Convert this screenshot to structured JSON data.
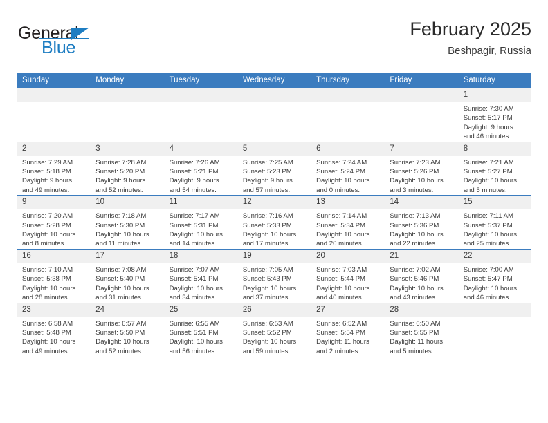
{
  "brand": {
    "name_line1": "General",
    "name_line2": "Blue",
    "logo_icon": "triangle-flag-icon",
    "accent_color": "#1d7dc2"
  },
  "header": {
    "title": "February 2025",
    "subtitle": "Beshpagir, Russia"
  },
  "theme": {
    "header_blue": "#3b7cbf",
    "daynum_band": "#f0f0f0",
    "text": "#3b3b3b"
  },
  "calendar": {
    "weekday_headers": [
      "Sunday",
      "Monday",
      "Tuesday",
      "Wednesday",
      "Thursday",
      "Friday",
      "Saturday"
    ],
    "labels": {
      "sunrise": "Sunrise:",
      "sunset": "Sunset:",
      "daylight": "Daylight:"
    },
    "weeks": [
      [
        {
          "day": "",
          "sunrise": "",
          "sunset": "",
          "daylight_l1": "",
          "daylight_l2": ""
        },
        {
          "day": "",
          "sunrise": "",
          "sunset": "",
          "daylight_l1": "",
          "daylight_l2": ""
        },
        {
          "day": "",
          "sunrise": "",
          "sunset": "",
          "daylight_l1": "",
          "daylight_l2": ""
        },
        {
          "day": "",
          "sunrise": "",
          "sunset": "",
          "daylight_l1": "",
          "daylight_l2": ""
        },
        {
          "day": "",
          "sunrise": "",
          "sunset": "",
          "daylight_l1": "",
          "daylight_l2": ""
        },
        {
          "day": "",
          "sunrise": "",
          "sunset": "",
          "daylight_l1": "",
          "daylight_l2": ""
        },
        {
          "day": "1",
          "sunrise": "Sunrise: 7:30 AM",
          "sunset": "Sunset: 5:17 PM",
          "daylight_l1": "Daylight: 9 hours",
          "daylight_l2": "and 46 minutes."
        }
      ],
      [
        {
          "day": "2",
          "sunrise": "Sunrise: 7:29 AM",
          "sunset": "Sunset: 5:18 PM",
          "daylight_l1": "Daylight: 9 hours",
          "daylight_l2": "and 49 minutes."
        },
        {
          "day": "3",
          "sunrise": "Sunrise: 7:28 AM",
          "sunset": "Sunset: 5:20 PM",
          "daylight_l1": "Daylight: 9 hours",
          "daylight_l2": "and 52 minutes."
        },
        {
          "day": "4",
          "sunrise": "Sunrise: 7:26 AM",
          "sunset": "Sunset: 5:21 PM",
          "daylight_l1": "Daylight: 9 hours",
          "daylight_l2": "and 54 minutes."
        },
        {
          "day": "5",
          "sunrise": "Sunrise: 7:25 AM",
          "sunset": "Sunset: 5:23 PM",
          "daylight_l1": "Daylight: 9 hours",
          "daylight_l2": "and 57 minutes."
        },
        {
          "day": "6",
          "sunrise": "Sunrise: 7:24 AM",
          "sunset": "Sunset: 5:24 PM",
          "daylight_l1": "Daylight: 10 hours",
          "daylight_l2": "and 0 minutes."
        },
        {
          "day": "7",
          "sunrise": "Sunrise: 7:23 AM",
          "sunset": "Sunset: 5:26 PM",
          "daylight_l1": "Daylight: 10 hours",
          "daylight_l2": "and 3 minutes."
        },
        {
          "day": "8",
          "sunrise": "Sunrise: 7:21 AM",
          "sunset": "Sunset: 5:27 PM",
          "daylight_l1": "Daylight: 10 hours",
          "daylight_l2": "and 5 minutes."
        }
      ],
      [
        {
          "day": "9",
          "sunrise": "Sunrise: 7:20 AM",
          "sunset": "Sunset: 5:28 PM",
          "daylight_l1": "Daylight: 10 hours",
          "daylight_l2": "and 8 minutes."
        },
        {
          "day": "10",
          "sunrise": "Sunrise: 7:18 AM",
          "sunset": "Sunset: 5:30 PM",
          "daylight_l1": "Daylight: 10 hours",
          "daylight_l2": "and 11 minutes."
        },
        {
          "day": "11",
          "sunrise": "Sunrise: 7:17 AM",
          "sunset": "Sunset: 5:31 PM",
          "daylight_l1": "Daylight: 10 hours",
          "daylight_l2": "and 14 minutes."
        },
        {
          "day": "12",
          "sunrise": "Sunrise: 7:16 AM",
          "sunset": "Sunset: 5:33 PM",
          "daylight_l1": "Daylight: 10 hours",
          "daylight_l2": "and 17 minutes."
        },
        {
          "day": "13",
          "sunrise": "Sunrise: 7:14 AM",
          "sunset": "Sunset: 5:34 PM",
          "daylight_l1": "Daylight: 10 hours",
          "daylight_l2": "and 20 minutes."
        },
        {
          "day": "14",
          "sunrise": "Sunrise: 7:13 AM",
          "sunset": "Sunset: 5:36 PM",
          "daylight_l1": "Daylight: 10 hours",
          "daylight_l2": "and 22 minutes."
        },
        {
          "day": "15",
          "sunrise": "Sunrise: 7:11 AM",
          "sunset": "Sunset: 5:37 PM",
          "daylight_l1": "Daylight: 10 hours",
          "daylight_l2": "and 25 minutes."
        }
      ],
      [
        {
          "day": "16",
          "sunrise": "Sunrise: 7:10 AM",
          "sunset": "Sunset: 5:38 PM",
          "daylight_l1": "Daylight: 10 hours",
          "daylight_l2": "and 28 minutes."
        },
        {
          "day": "17",
          "sunrise": "Sunrise: 7:08 AM",
          "sunset": "Sunset: 5:40 PM",
          "daylight_l1": "Daylight: 10 hours",
          "daylight_l2": "and 31 minutes."
        },
        {
          "day": "18",
          "sunrise": "Sunrise: 7:07 AM",
          "sunset": "Sunset: 5:41 PM",
          "daylight_l1": "Daylight: 10 hours",
          "daylight_l2": "and 34 minutes."
        },
        {
          "day": "19",
          "sunrise": "Sunrise: 7:05 AM",
          "sunset": "Sunset: 5:43 PM",
          "daylight_l1": "Daylight: 10 hours",
          "daylight_l2": "and 37 minutes."
        },
        {
          "day": "20",
          "sunrise": "Sunrise: 7:03 AM",
          "sunset": "Sunset: 5:44 PM",
          "daylight_l1": "Daylight: 10 hours",
          "daylight_l2": "and 40 minutes."
        },
        {
          "day": "21",
          "sunrise": "Sunrise: 7:02 AM",
          "sunset": "Sunset: 5:46 PM",
          "daylight_l1": "Daylight: 10 hours",
          "daylight_l2": "and 43 minutes."
        },
        {
          "day": "22",
          "sunrise": "Sunrise: 7:00 AM",
          "sunset": "Sunset: 5:47 PM",
          "daylight_l1": "Daylight: 10 hours",
          "daylight_l2": "and 46 minutes."
        }
      ],
      [
        {
          "day": "23",
          "sunrise": "Sunrise: 6:58 AM",
          "sunset": "Sunset: 5:48 PM",
          "daylight_l1": "Daylight: 10 hours",
          "daylight_l2": "and 49 minutes."
        },
        {
          "day": "24",
          "sunrise": "Sunrise: 6:57 AM",
          "sunset": "Sunset: 5:50 PM",
          "daylight_l1": "Daylight: 10 hours",
          "daylight_l2": "and 52 minutes."
        },
        {
          "day": "25",
          "sunrise": "Sunrise: 6:55 AM",
          "sunset": "Sunset: 5:51 PM",
          "daylight_l1": "Daylight: 10 hours",
          "daylight_l2": "and 56 minutes."
        },
        {
          "day": "26",
          "sunrise": "Sunrise: 6:53 AM",
          "sunset": "Sunset: 5:52 PM",
          "daylight_l1": "Daylight: 10 hours",
          "daylight_l2": "and 59 minutes."
        },
        {
          "day": "27",
          "sunrise": "Sunrise: 6:52 AM",
          "sunset": "Sunset: 5:54 PM",
          "daylight_l1": "Daylight: 11 hours",
          "daylight_l2": "and 2 minutes."
        },
        {
          "day": "28",
          "sunrise": "Sunrise: 6:50 AM",
          "sunset": "Sunset: 5:55 PM",
          "daylight_l1": "Daylight: 11 hours",
          "daylight_l2": "and 5 minutes."
        },
        {
          "day": "",
          "sunrise": "",
          "sunset": "",
          "daylight_l1": "",
          "daylight_l2": ""
        }
      ]
    ]
  }
}
